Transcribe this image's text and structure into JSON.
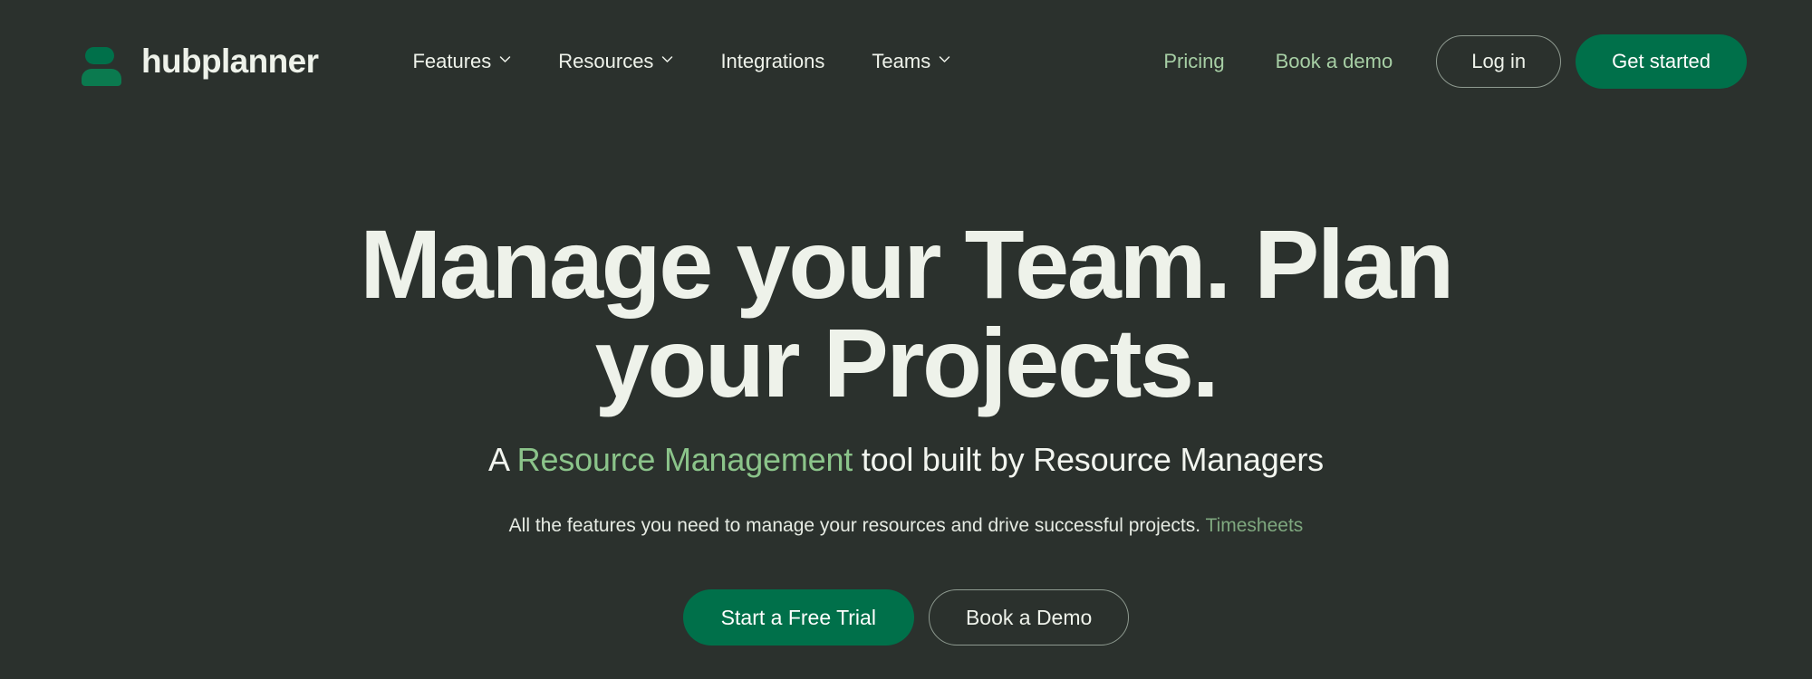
{
  "theme": {
    "background": "#2b312d",
    "text_primary": "#eef2ea",
    "accent_green": "#00704a",
    "accent_green_light": "#8bc48a",
    "nav_link_green": "#a7cfa5",
    "muted_green": "#7fa87f",
    "border_gray": "#8e9a90"
  },
  "header": {
    "brand": {
      "name": "hubplanner",
      "logo_icon": "hubplanner-logo-icon"
    },
    "nav": [
      {
        "label": "Features",
        "has_dropdown": true,
        "icon": "chevron-down-icon"
      },
      {
        "label": "Resources",
        "has_dropdown": true,
        "icon": "chevron-down-icon"
      },
      {
        "label": "Integrations",
        "has_dropdown": false,
        "icon": ""
      },
      {
        "label": "Teams",
        "has_dropdown": true,
        "icon": "chevron-down-icon"
      }
    ],
    "nav_right_links": [
      {
        "label": "Pricing"
      },
      {
        "label": "Book a demo"
      }
    ],
    "login_label": "Log in",
    "get_started_label": "Get started"
  },
  "hero": {
    "headline_line1": "Manage your Team. Plan",
    "headline_line2": "your Projects.",
    "subheadline_before": "A ",
    "subheadline_accent": "Resource Management",
    "subheadline_after": " tool built by Resource Managers",
    "description_text": "All the features you need to manage your resources and drive successful projects. ",
    "description_link": "Timesheets",
    "cta_primary": "Start a Free Trial",
    "cta_secondary": "Book a Demo"
  }
}
